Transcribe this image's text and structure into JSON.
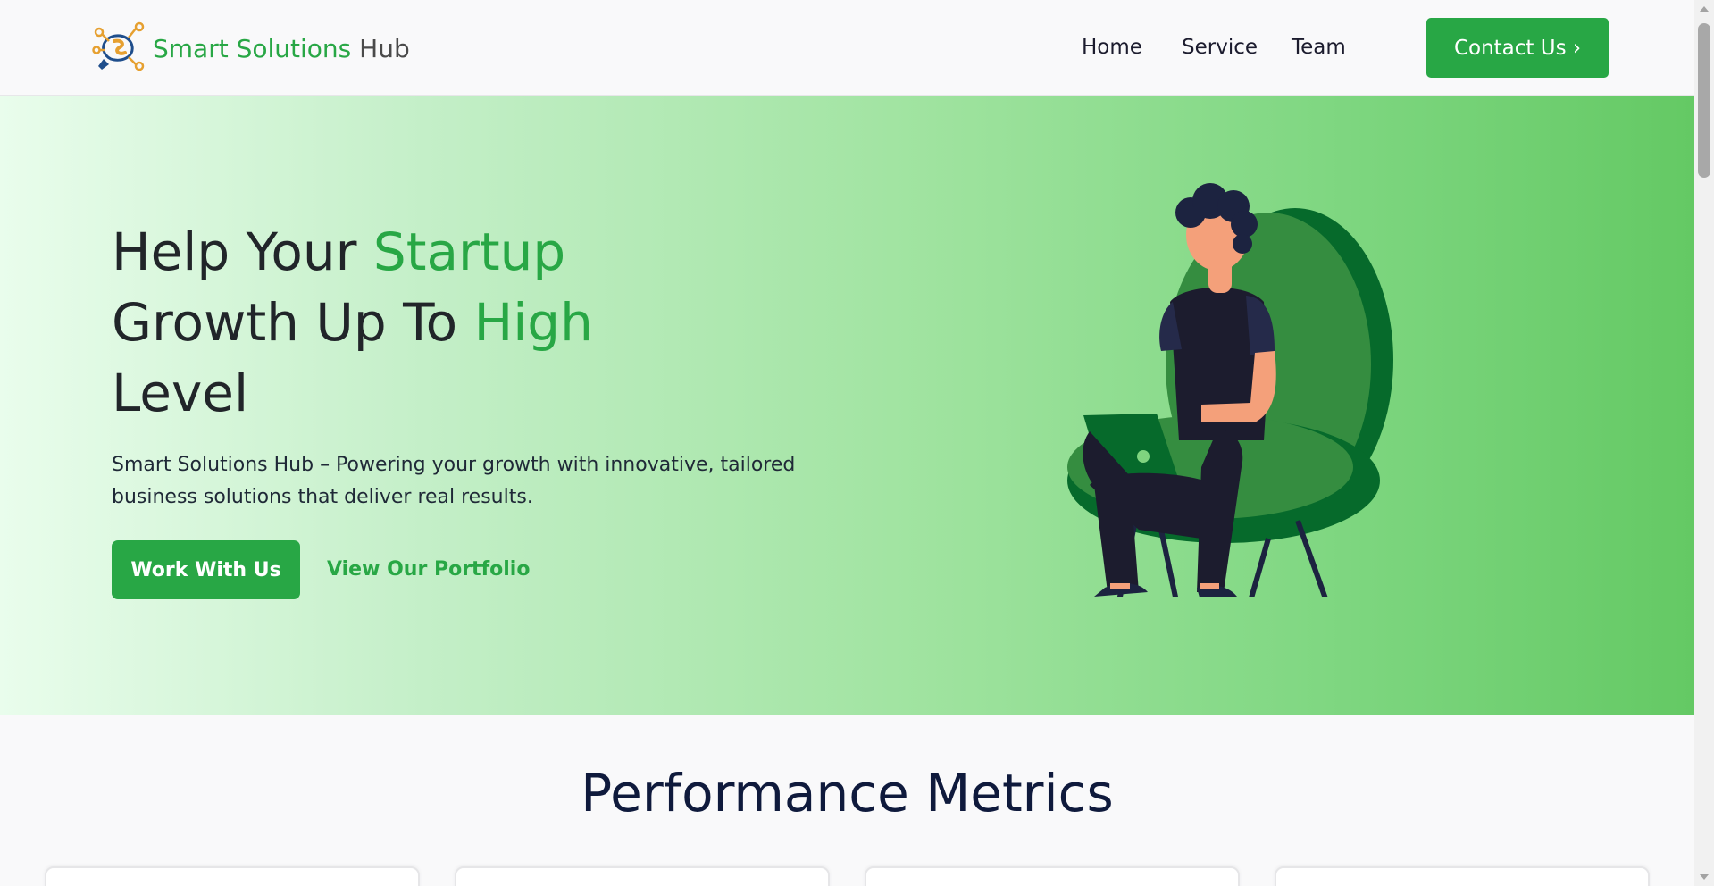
{
  "brand": {
    "name_part1": "Smart Solutions",
    "name_part2": "Hub",
    "logo_icon": "lightbulb-network-logo"
  },
  "nav": {
    "items": [
      "Home",
      "Service",
      "Team"
    ],
    "contact_label": "Contact Us ›"
  },
  "hero": {
    "title_line1_a": "Help Your ",
    "title_line1_b": "Startup",
    "title_line2_a": "Growth Up To ",
    "title_line2_b": "High",
    "title_line3": "Level",
    "description": "Smart Solutions Hub – Powering your growth with innovative, tailored business solutions that deliver real results.",
    "primary_button": "Work With Us",
    "secondary_link": "View Our Portfolio",
    "illustration": "person-with-laptop-in-chair"
  },
  "metrics": {
    "title": "Performance Metrics"
  },
  "colors": {
    "accent": "#28a745",
    "heading": "#0f1a3c",
    "hero_gradient_start": "#e9fdec",
    "hero_gradient_end": "#64c964"
  }
}
